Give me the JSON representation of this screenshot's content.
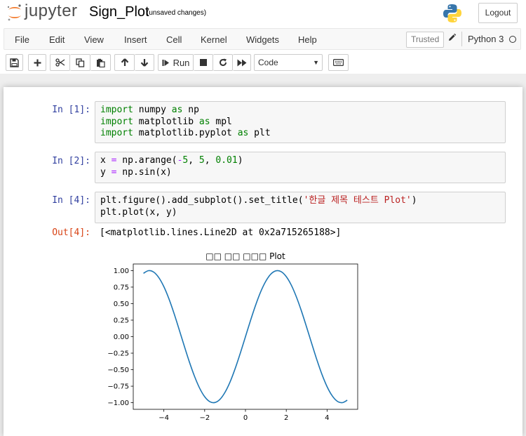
{
  "header": {
    "logo_text": "jupyter",
    "notebook_name": "Sign_Plot",
    "save_status": "(unsaved changes)",
    "logout_label": "Logout"
  },
  "menubar": {
    "items": [
      "File",
      "Edit",
      "View",
      "Insert",
      "Cell",
      "Kernel",
      "Widgets",
      "Help"
    ],
    "trusted_label": "Trusted",
    "kernel_name": "Python 3"
  },
  "toolbar": {
    "run_label": "Run",
    "cell_type": "Code"
  },
  "cells": [
    {
      "prompt": "In [1]:",
      "lines": [
        [
          [
            "kw",
            "import"
          ],
          [
            "t",
            " numpy "
          ],
          [
            "kw",
            "as"
          ],
          [
            "t",
            " np"
          ]
        ],
        [
          [
            "kw",
            "import"
          ],
          [
            "t",
            " matplotlib "
          ],
          [
            "kw",
            "as"
          ],
          [
            "t",
            " mpl"
          ]
        ],
        [
          [
            "kw",
            "import"
          ],
          [
            "t",
            " matplotlib.pyplot "
          ],
          [
            "kw",
            "as"
          ],
          [
            "t",
            " plt"
          ]
        ]
      ]
    },
    {
      "prompt": "In [2]:",
      "lines": [
        [
          [
            "t",
            "x "
          ],
          [
            "op",
            "="
          ],
          [
            "t",
            " np.arange("
          ],
          [
            "op",
            "-"
          ],
          [
            "num",
            "5"
          ],
          [
            "t",
            ", "
          ],
          [
            "num",
            "5"
          ],
          [
            "t",
            ", "
          ],
          [
            "num",
            "0.01"
          ],
          [
            "t",
            ")"
          ]
        ],
        [
          [
            "t",
            "y "
          ],
          [
            "op",
            "="
          ],
          [
            "t",
            " np.sin(x)"
          ]
        ]
      ]
    },
    {
      "prompt": "In [4]:",
      "lines": [
        [
          [
            "t",
            "plt.figure().add_subplot().set_title("
          ],
          [
            "str",
            "'한글 제목 테스트 Plot'"
          ],
          [
            "t",
            ")"
          ]
        ],
        [
          [
            "t",
            "plt.plot(x, y)"
          ]
        ]
      ]
    }
  ],
  "output": {
    "prompt": "Out[4]:",
    "text": "[<matplotlib.lines.Line2D at 0x2a715265188>]"
  },
  "chart_data": {
    "type": "line",
    "title": "□□ □□ □□□ Plot",
    "xlabel": "",
    "ylabel": "",
    "xlim": [
      -5.5,
      5.5
    ],
    "ylim": [
      -1.1,
      1.1
    ],
    "xticks": [
      -4,
      -2,
      0,
      2,
      4
    ],
    "xtick_labels": [
      "−4",
      "−2",
      "0",
      "2",
      "4"
    ],
    "yticks": [
      1.0,
      0.75,
      0.5,
      0.25,
      0.0,
      -0.25,
      -0.5,
      -0.75,
      -1.0
    ],
    "ytick_labels": [
      "1.00",
      "0.75",
      "0.50",
      "0.25",
      "0.00",
      "−0.25",
      "−0.50",
      "−0.75",
      "−1.00"
    ],
    "grid": false,
    "series": [
      {
        "color": "#1f77b4",
        "x": [
          -5.0,
          -4.75,
          -4.5,
          -4.25,
          -4.0,
          -3.75,
          -3.5,
          -3.25,
          -3.0,
          -2.75,
          -2.5,
          -2.25,
          -2.0,
          -1.75,
          -1.5,
          -1.25,
          -1.0,
          -0.75,
          -0.5,
          -0.25,
          0.0,
          0.25,
          0.5,
          0.75,
          1.0,
          1.25,
          1.5,
          1.75,
          2.0,
          2.25,
          2.5,
          2.75,
          3.0,
          3.25,
          3.5,
          3.75,
          4.0,
          4.25,
          4.5,
          4.75,
          4.99
        ],
        "y": [
          0.959,
          0.999,
          0.978,
          0.895,
          0.757,
          0.572,
          0.351,
          0.108,
          -0.141,
          -0.382,
          -0.598,
          -0.778,
          -0.909,
          -0.984,
          -0.997,
          -0.949,
          -0.841,
          -0.682,
          -0.479,
          -0.247,
          0.0,
          0.247,
          0.479,
          0.682,
          0.841,
          0.949,
          0.997,
          0.984,
          0.909,
          0.778,
          0.598,
          0.382,
          0.141,
          -0.108,
          -0.351,
          -0.572,
          -0.757,
          -0.895,
          -0.978,
          -0.999,
          -0.962
        ]
      }
    ]
  }
}
